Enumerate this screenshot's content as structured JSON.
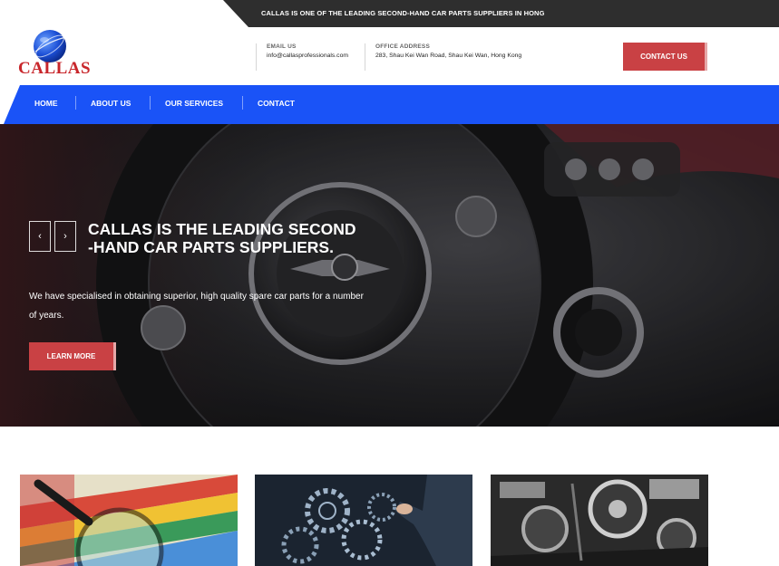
{
  "topbar": {
    "tagline": "CALLAS IS ONE OF THE LEADING SECOND-HAND CAR PARTS SUPPLIERS IN HONG"
  },
  "logo": {
    "text": "CALLAS"
  },
  "header": {
    "email_label": "EMAIL US",
    "email_value": "info@callasprofessionals.com",
    "address_label": "OFFICE ADDRESS",
    "address_value": "283, Shau Kei Wan Road, Shau Kei Wan, Hong Kong",
    "contact_button": "CONTACT US"
  },
  "nav": {
    "items": [
      "HOME",
      "ABOUT US",
      "OUR SERVICES",
      "CONTACT"
    ]
  },
  "hero": {
    "prev": "‹",
    "next": "›",
    "title": "CALLAS IS THE LEADING SECOND -HAND CAR PARTS SUPPLIERS.",
    "subtitle": "We have specialised in obtaining superior, high quality spare car parts for a number of years.",
    "button": "LEARN MORE"
  },
  "colors": {
    "nav_blue": "#1a53f7",
    "accent_red": "#c94144",
    "topbar_dark": "#2e2e2e"
  },
  "icons": {
    "logo": "globe-icon",
    "prev": "chevron-left-icon",
    "next": "chevron-right-icon"
  }
}
